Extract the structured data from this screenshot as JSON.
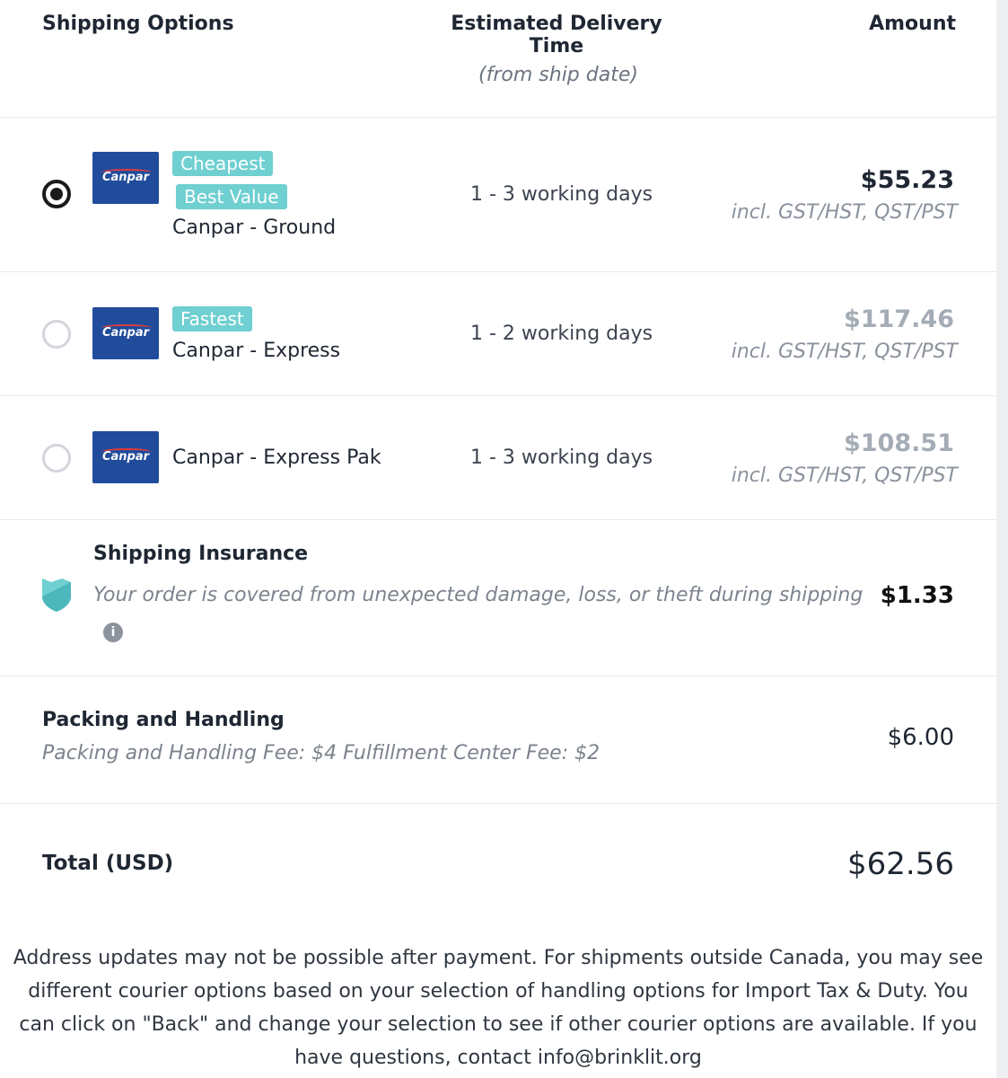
{
  "header": {
    "col_options": "Shipping Options",
    "col_delivery": "Estimated Delivery Time",
    "col_delivery_sub": "(from ship date)",
    "col_amount": "Amount"
  },
  "carrier_logo_text": "Canpar",
  "options": [
    {
      "selected": true,
      "tags": [
        "Cheapest",
        "Best Value"
      ],
      "name": "Canpar - Ground",
      "delivery": "1 - 3 working days",
      "price": "$55.23",
      "tax_note": "incl. GST/HST, QST/PST"
    },
    {
      "selected": false,
      "tags": [
        "Fastest"
      ],
      "name": "Canpar - Express",
      "delivery": "1 - 2 working days",
      "price": "$117.46",
      "tax_note": "incl. GST/HST, QST/PST"
    },
    {
      "selected": false,
      "tags": [],
      "name": "Canpar - Express Pak",
      "delivery": "1 - 3 working days",
      "price": "$108.51",
      "tax_note": "incl. GST/HST, QST/PST"
    }
  ],
  "insurance": {
    "title": "Shipping Insurance",
    "description": "Your order is covered from unexpected damage, loss, or theft during shipping",
    "amount": "$1.33",
    "info_icon_glyph": "i"
  },
  "handling": {
    "title": "Packing and Handling",
    "description": "Packing and Handling Fee: $4 Fulfillment Center Fee: $2",
    "amount": "$6.00"
  },
  "total": {
    "label": "Total (USD)",
    "amount": "$62.56"
  },
  "notice": "Address updates may not be possible after payment. For shipments outside Canada, you may see different courier options based on your selection of handling options for Import Tax & Duty. You can click on \"Back\" and change your selection to see if other courier options are available. If you have questions, contact info@brinklit.org",
  "colors": {
    "tag_bg": "#6fcfd1",
    "carrier_blue": "#214c9c",
    "shield": "#6fcfd1"
  },
  "icons": {
    "radio_selected": "radio-selected-icon",
    "radio_unselected": "radio-unselected-icon",
    "shield": "shield-icon",
    "info": "info-icon"
  }
}
